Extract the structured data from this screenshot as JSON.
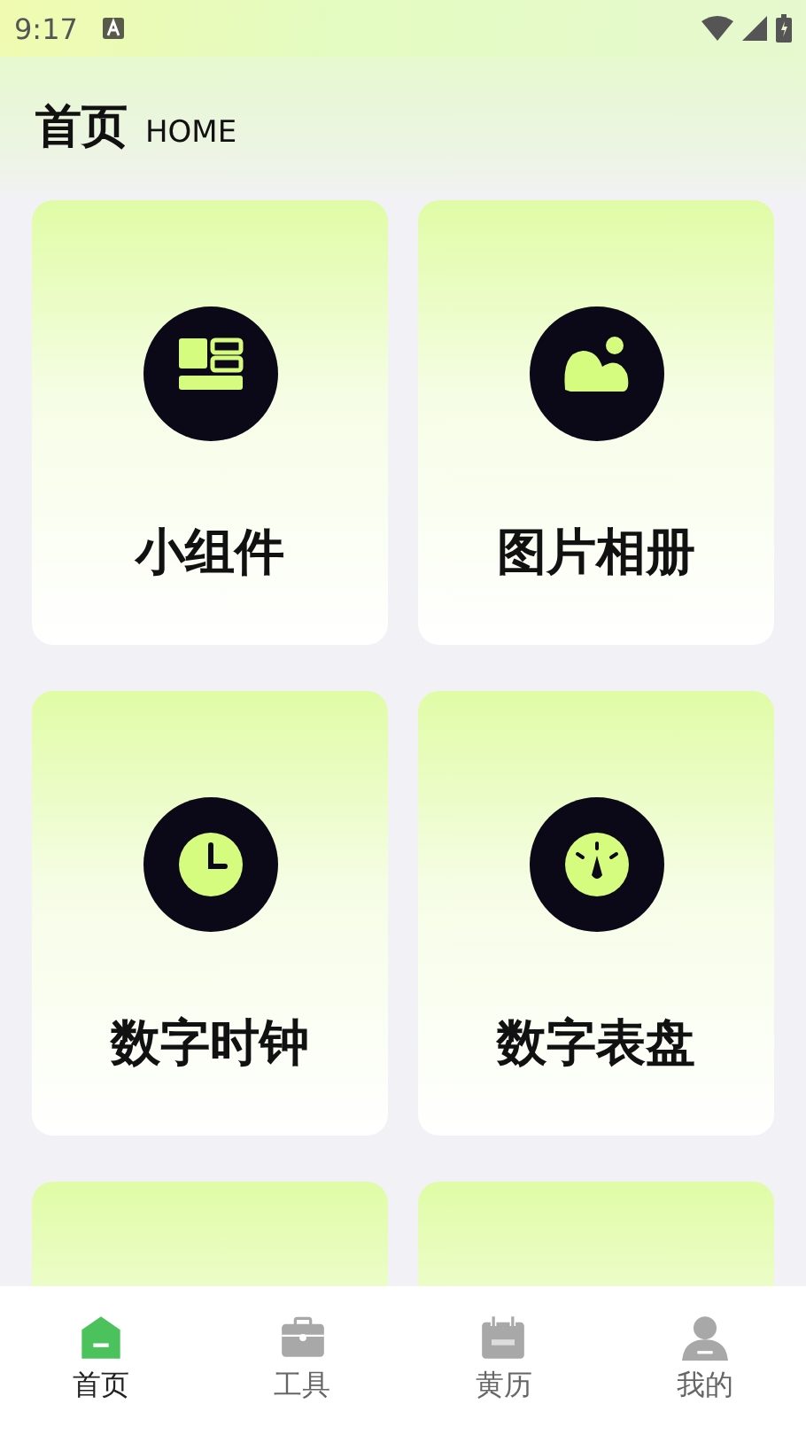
{
  "status_bar": {
    "time": "9:17"
  },
  "header": {
    "title": "首页",
    "subtitle": "HOME"
  },
  "cards": [
    {
      "kind": "widget",
      "label": "小组件"
    },
    {
      "kind": "photo",
      "label": "图片相册"
    },
    {
      "kind": "clock",
      "label": "数字时钟"
    },
    {
      "kind": "dial",
      "label": "数字表盘"
    },
    {
      "kind": "partial"
    },
    {
      "kind": "partial"
    }
  ],
  "nav": [
    {
      "kind": "home",
      "label": "首页",
      "selected": true
    },
    {
      "kind": "tools",
      "label": "工具",
      "selected": false
    },
    {
      "kind": "calendar",
      "label": "黄历",
      "selected": false
    },
    {
      "kind": "profile",
      "label": "我的",
      "selected": false
    }
  ]
}
